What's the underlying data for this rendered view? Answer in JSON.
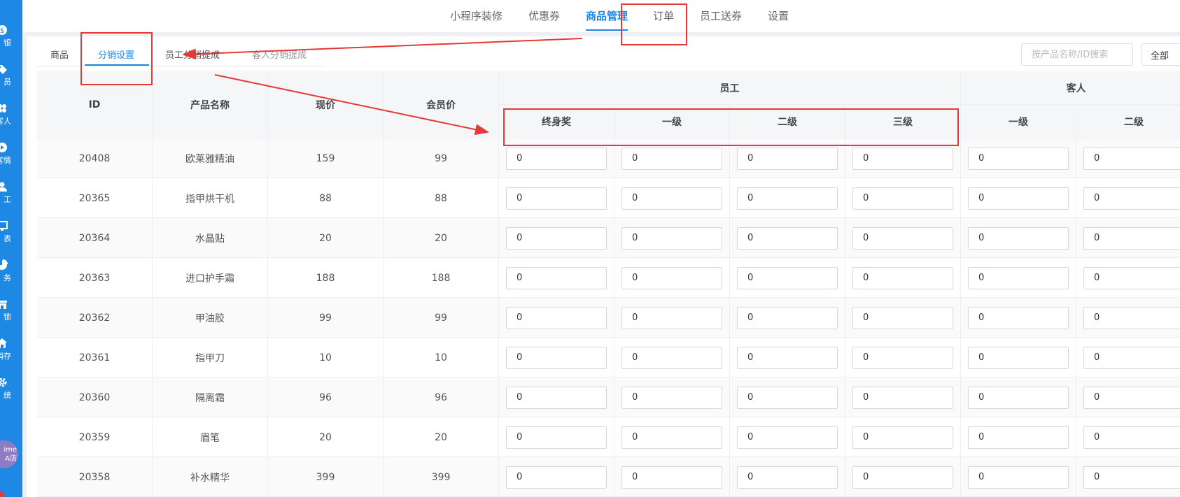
{
  "sidebar": {
    "items": [
      {
        "icon": "cash-icon",
        "label": "银"
      },
      {
        "icon": "tag-icon",
        "label": "员"
      },
      {
        "icon": "customers-icon",
        "label": "客人"
      },
      {
        "icon": "play-icon",
        "label": "客情"
      },
      {
        "icon": "user-icon",
        "label": "工"
      },
      {
        "icon": "report-icon",
        "label": "表"
      },
      {
        "icon": "pie-icon",
        "label": "务"
      },
      {
        "icon": "store-icon",
        "label": "锁"
      },
      {
        "icon": "home-icon",
        "label": "销存"
      },
      {
        "icon": "gear-icon",
        "label": "统"
      }
    ],
    "avatar_line1": "ime",
    "avatar_line2": "A店"
  },
  "topnav": {
    "tabs": [
      "小程序装修",
      "优惠券",
      "商品管理",
      "订单",
      "员工送券",
      "设置"
    ],
    "active": "商品管理"
  },
  "subtabs": {
    "tabs": [
      "商品",
      "分销设置",
      "员工分销提成",
      "客人分销提成"
    ],
    "active": "分销设置"
  },
  "search": {
    "placeholder": "按产品名称/ID搜索",
    "button_label": "全部"
  },
  "table": {
    "columns": {
      "id": "ID",
      "name": "产品名称",
      "price": "现价",
      "member_price": "会员价",
      "staff_group": "员工",
      "staff_lifetime": "终身奖",
      "staff_l1": "一级",
      "staff_l2": "二级",
      "staff_l3": "三级",
      "guest_group": "客人",
      "guest_l1": "一级",
      "guest_l2": "二级"
    },
    "rows": [
      {
        "id": "20408",
        "name": "欧莱雅精油",
        "price": "159",
        "member_price": "99",
        "values": [
          "0",
          "0",
          "0",
          "0",
          "0",
          "0"
        ]
      },
      {
        "id": "20365",
        "name": "指甲烘干机",
        "price": "88",
        "member_price": "88",
        "values": [
          "0",
          "0",
          "0",
          "0",
          "0",
          "0"
        ]
      },
      {
        "id": "20364",
        "name": "水晶贴",
        "price": "20",
        "member_price": "20",
        "values": [
          "0",
          "0",
          "0",
          "0",
          "0",
          "0"
        ]
      },
      {
        "id": "20363",
        "name": "进口护手霜",
        "price": "188",
        "member_price": "188",
        "values": [
          "0",
          "0",
          "0",
          "0",
          "0",
          "0"
        ]
      },
      {
        "id": "20362",
        "name": "甲油胶",
        "price": "99",
        "member_price": "99",
        "values": [
          "0",
          "0",
          "0",
          "0",
          "0",
          "0"
        ]
      },
      {
        "id": "20361",
        "name": "指甲刀",
        "price": "10",
        "member_price": "10",
        "values": [
          "0",
          "0",
          "0",
          "0",
          "0",
          "0"
        ]
      },
      {
        "id": "20360",
        "name": "隔离霜",
        "price": "96",
        "member_price": "96",
        "values": [
          "0",
          "0",
          "0",
          "0",
          "0",
          "0"
        ]
      },
      {
        "id": "20359",
        "name": "眉笔",
        "price": "20",
        "member_price": "20",
        "values": [
          "0",
          "0",
          "0",
          "0",
          "0",
          "0"
        ]
      },
      {
        "id": "20358",
        "name": "补水精华",
        "price": "399",
        "member_price": "399",
        "values": [
          "0",
          "0",
          "0",
          "0",
          "0",
          "0"
        ]
      }
    ]
  },
  "colors": {
    "accent": "#1e88e5",
    "annotation": "#e53935"
  }
}
